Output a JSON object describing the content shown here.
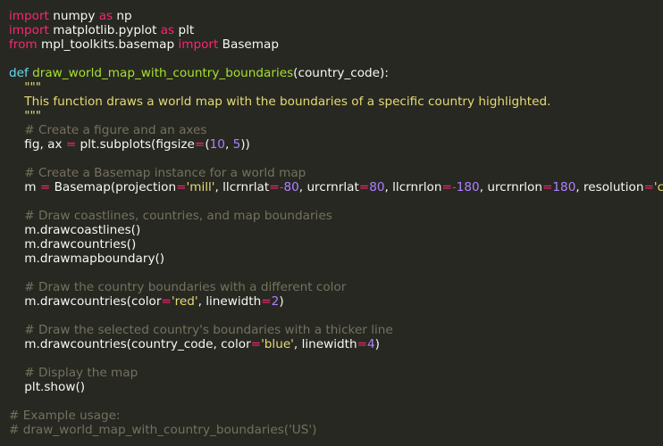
{
  "theme": {
    "background": "#272822",
    "default": "#f8f8f2",
    "keyword": "#f92672",
    "function": "#a6e22e",
    "string": "#e6db74",
    "number": "#ae81ff",
    "comment": "#75715e",
    "def_keyword": "#66d9ef"
  },
  "code": {
    "lines": [
      [
        {
          "t": "import",
          "c": "kw"
        },
        {
          "t": " numpy ",
          "c": "id"
        },
        {
          "t": "as",
          "c": "kw"
        },
        {
          "t": " np",
          "c": "id"
        }
      ],
      [
        {
          "t": "import",
          "c": "kw"
        },
        {
          "t": " matplotlib.pyplot ",
          "c": "id"
        },
        {
          "t": "as",
          "c": "kw"
        },
        {
          "t": " plt",
          "c": "id"
        }
      ],
      [
        {
          "t": "from",
          "c": "kw"
        },
        {
          "t": " mpl_toolkits.basemap ",
          "c": "id"
        },
        {
          "t": "import",
          "c": "kw"
        },
        {
          "t": " Basemap",
          "c": "id"
        }
      ],
      [],
      [
        {
          "t": "def",
          "c": "dkw"
        },
        {
          "t": " ",
          "c": "id"
        },
        {
          "t": "draw_world_map_with_country_boundaries",
          "c": "fn"
        },
        {
          "t": "(country_code):",
          "c": "id"
        }
      ],
      [
        {
          "t": "    \"\"\"",
          "c": "str"
        }
      ],
      [
        {
          "t": "    This function draws a world map with the boundaries of a specific country highlighted.",
          "c": "str"
        }
      ],
      [
        {
          "t": "    \"\"\"",
          "c": "str"
        }
      ],
      [
        {
          "t": "    # Create a figure and an axes",
          "c": "cmt"
        }
      ],
      [
        {
          "t": "    fig, ax ",
          "c": "id"
        },
        {
          "t": "=",
          "c": "op"
        },
        {
          "t": " plt.subplots(figsize",
          "c": "id"
        },
        {
          "t": "=",
          "c": "op"
        },
        {
          "t": "(",
          "c": "id"
        },
        {
          "t": "10",
          "c": "num"
        },
        {
          "t": ", ",
          "c": "id"
        },
        {
          "t": "5",
          "c": "num"
        },
        {
          "t": "))",
          "c": "id"
        }
      ],
      [],
      [
        {
          "t": "    # Create a Basemap instance for a world map",
          "c": "cmt"
        }
      ],
      [
        {
          "t": "    m ",
          "c": "id"
        },
        {
          "t": "=",
          "c": "op"
        },
        {
          "t": " Basemap(projection",
          "c": "id"
        },
        {
          "t": "=",
          "c": "op"
        },
        {
          "t": "'mill'",
          "c": "str"
        },
        {
          "t": ", llcrnrlat",
          "c": "id"
        },
        {
          "t": "=-",
          "c": "op"
        },
        {
          "t": "80",
          "c": "num"
        },
        {
          "t": ", urcrnrlat",
          "c": "id"
        },
        {
          "t": "=",
          "c": "op"
        },
        {
          "t": "80",
          "c": "num"
        },
        {
          "t": ", llcrnrlon",
          "c": "id"
        },
        {
          "t": "=-",
          "c": "op"
        },
        {
          "t": "180",
          "c": "num"
        },
        {
          "t": ", urcrnrlon",
          "c": "id"
        },
        {
          "t": "=",
          "c": "op"
        },
        {
          "t": "180",
          "c": "num"
        },
        {
          "t": ", resolution",
          "c": "id"
        },
        {
          "t": "=",
          "c": "op"
        },
        {
          "t": "'c'",
          "c": "str"
        },
        {
          "t": ")",
          "c": "id"
        }
      ],
      [],
      [
        {
          "t": "    # Draw coastlines, countries, and map boundaries",
          "c": "cmt"
        }
      ],
      [
        {
          "t": "    m.drawcoastlines()",
          "c": "id"
        }
      ],
      [
        {
          "t": "    m.drawcountries()",
          "c": "id"
        }
      ],
      [
        {
          "t": "    m.drawmapboundary()",
          "c": "id"
        }
      ],
      [],
      [
        {
          "t": "    # Draw the country boundaries with a different color",
          "c": "cmt"
        }
      ],
      [
        {
          "t": "    m.drawcountries(color",
          "c": "id"
        },
        {
          "t": "=",
          "c": "op"
        },
        {
          "t": "'red'",
          "c": "str"
        },
        {
          "t": ", linewidth",
          "c": "id"
        },
        {
          "t": "=",
          "c": "op"
        },
        {
          "t": "2",
          "c": "num"
        },
        {
          "t": ")",
          "c": "id"
        }
      ],
      [],
      [
        {
          "t": "    # Draw the selected country's boundaries with a thicker line",
          "c": "cmt"
        }
      ],
      [
        {
          "t": "    m.drawcountries(country_code, color",
          "c": "id"
        },
        {
          "t": "=",
          "c": "op"
        },
        {
          "t": "'blue'",
          "c": "str"
        },
        {
          "t": ", linewidth",
          "c": "id"
        },
        {
          "t": "=",
          "c": "op"
        },
        {
          "t": "4",
          "c": "num"
        },
        {
          "t": ")",
          "c": "id"
        }
      ],
      [],
      [
        {
          "t": "    # Display the map",
          "c": "cmt"
        }
      ],
      [
        {
          "t": "    plt.show()",
          "c": "id"
        }
      ],
      [],
      [
        {
          "t": "# Example usage:",
          "c": "cmt"
        }
      ],
      [
        {
          "t": "# draw_world_map_with_country_boundaries('US')",
          "c": "cmt"
        }
      ]
    ]
  }
}
